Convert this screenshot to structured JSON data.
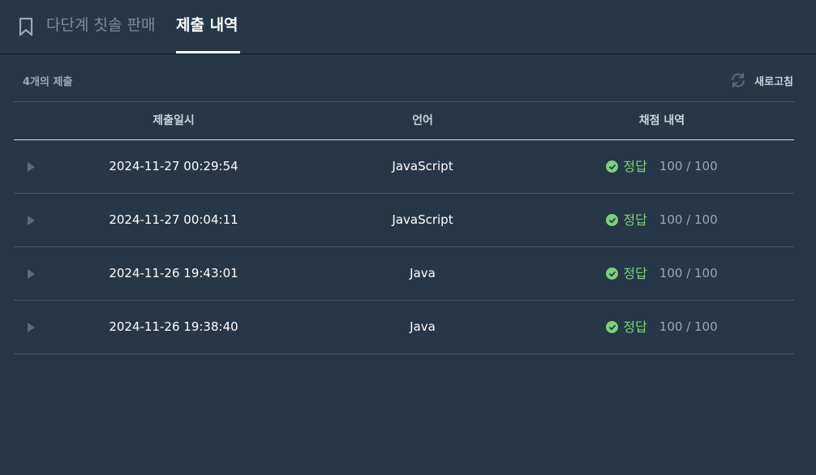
{
  "tabs": {
    "problem_label": "다단계 칫솔 판매",
    "submissions_label": "제출 내역"
  },
  "summary": "4개의 제출",
  "refresh_label": "새로고침",
  "columns": {
    "date": "제출일시",
    "language": "언어",
    "result": "채점 내역"
  },
  "rows": [
    {
      "date": "2024-11-27 00:29:54",
      "language": "JavaScript",
      "verdict": "정답",
      "score": "100 / 100"
    },
    {
      "date": "2024-11-27 00:04:11",
      "language": "JavaScript",
      "verdict": "정답",
      "score": "100 / 100"
    },
    {
      "date": "2024-11-26 19:43:01",
      "language": "Java",
      "verdict": "정답",
      "score": "100 / 100"
    },
    {
      "date": "2024-11-26 19:38:40",
      "language": "Java",
      "verdict": "정답",
      "score": "100 / 100"
    }
  ],
  "icons": {
    "bookmark": "bookmark-icon",
    "refresh": "refresh-icon",
    "expand": "caret-right-icon",
    "check": "check-circle-icon"
  },
  "colors": {
    "background": "#263747",
    "success": "#7ed07c",
    "muted": "#9aa8b5"
  }
}
